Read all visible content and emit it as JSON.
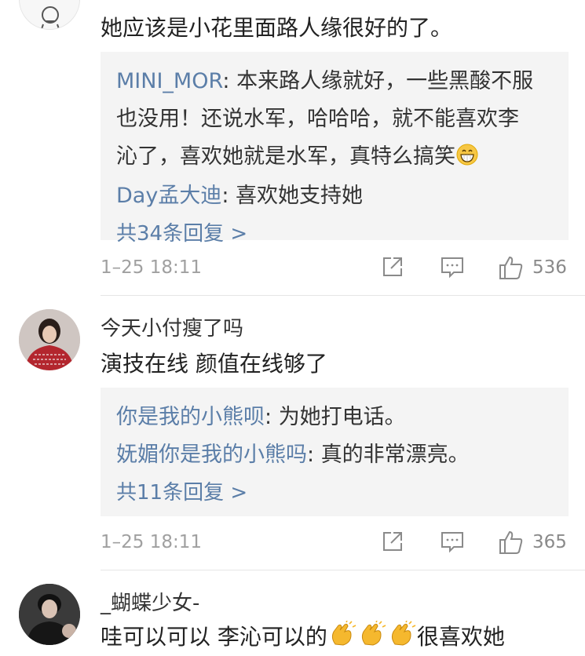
{
  "comments": [
    {
      "text": "她应该是小花里面路人缘很好的了。",
      "replies": [
        {
          "author": "MINI_MOR",
          "sep": ": ",
          "lines": [
            "本来路人缘就好，一些黑酸不服",
            "也没用！还说水军，哈哈哈，就不能喜欢李",
            "沁了，喜欢她就是水军，真特么搞笑"
          ]
        },
        {
          "author": "Day孟大迪",
          "sep": ": ",
          "text": "喜欢她支持她"
        }
      ],
      "more": "共34条回复 >",
      "time": "1–25 18:11",
      "likes": "536"
    },
    {
      "name": "今天小付瘦了吗",
      "text": "演技在线 颜值在线够了",
      "replies": [
        {
          "author": "你是我的小熊呗",
          "sep": ": ",
          "text": "为她打电话。"
        },
        {
          "author": "妩媚你是我的小熊吗",
          "sep": ": ",
          "text": "真的非常漂亮。"
        }
      ],
      "more": "共11条回复 >",
      "time": "1–25 18:11",
      "likes": "365"
    },
    {
      "name": "_蝴蝶少女-",
      "text_a": "哇可以可以 李沁可以的",
      "text_b": "很喜欢她"
    }
  ],
  "icons": {
    "share": "share-icon",
    "comment": "comment-icon",
    "like": "thumbs-up-icon",
    "emoji_grin": "grinning-emoji-icon",
    "emoji_clap": "clapping-hands-emoji-icon"
  },
  "colors": {
    "link": "#5b7ea8",
    "reply_bg": "#f4f4f4",
    "meta": "#a0a0a0"
  }
}
